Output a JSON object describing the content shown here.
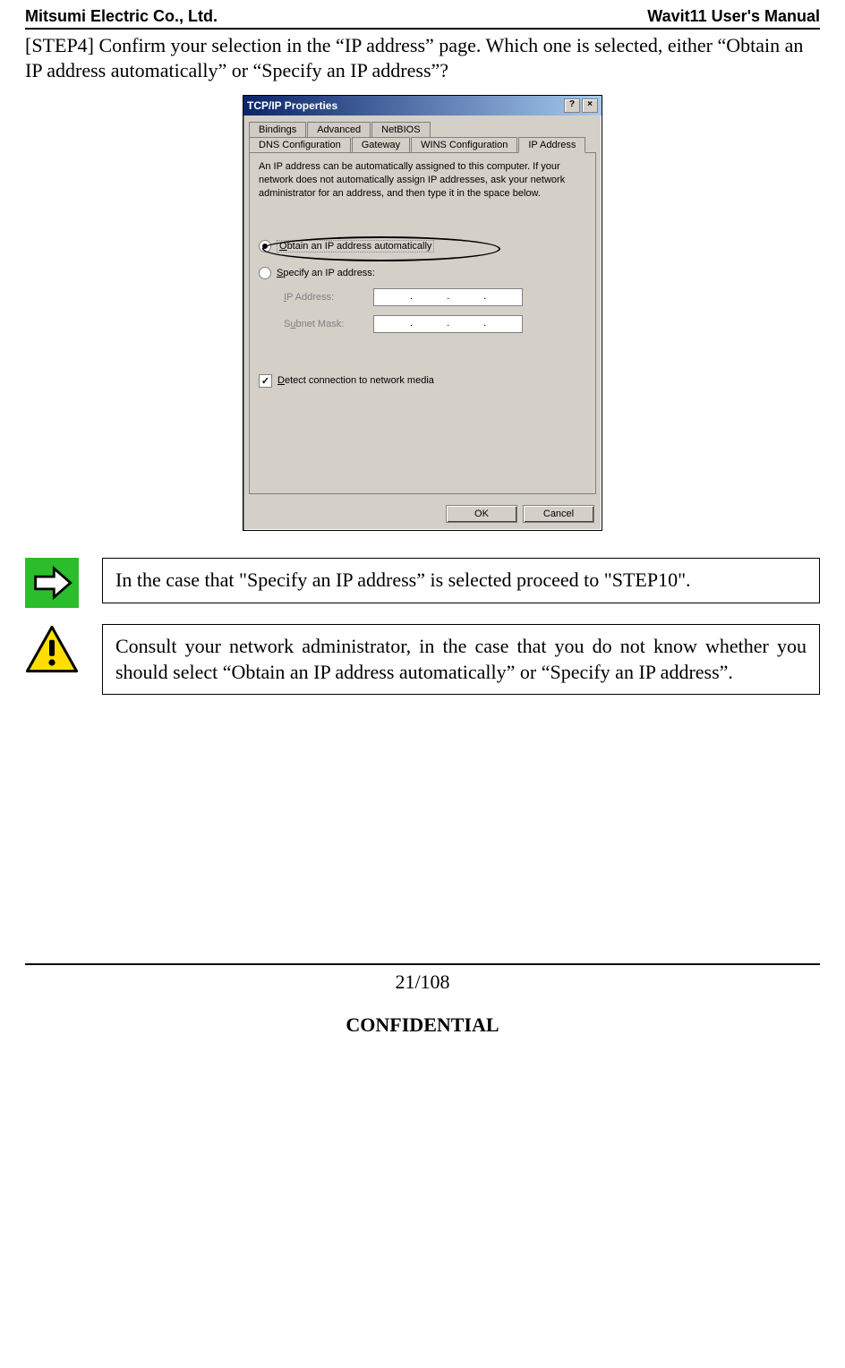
{
  "header": {
    "left": "Mitsumi Electric Co., Ltd.",
    "right": "Wavit11 User's Manual"
  },
  "intro": "[STEP4] Confirm your selection in the “IP address” page. Which one is selected, either “Obtain an IP address automatically” or “Specify an IP address”?",
  "dialog": {
    "title": "TCP/IP Properties",
    "help_glyph": "?",
    "close_glyph": "×",
    "tabs_row1": [
      "Bindings",
      "Advanced",
      "NetBIOS"
    ],
    "tabs_row2": [
      "DNS Configuration",
      "Gateway",
      "WINS Configuration",
      "IP Address"
    ],
    "active_tab": "IP Address",
    "description": "An IP address can be automatically assigned to this computer. If your network does not automatically assign IP addresses, ask your network administrator for an address, and then type it in the space below.",
    "radio_obtain": "Obtain an IP address automatically",
    "radio_obtain_selected": true,
    "radio_specify": "Specify an IP address:",
    "radio_specify_selected": false,
    "field_ip_label": "IP Address:",
    "field_subnet_label": "Subnet Mask:",
    "detect_label": "Detect connection to network media",
    "detect_checked": true,
    "btn_ok": "OK",
    "btn_cancel": "Cancel"
  },
  "note_go": "In the case that \"Specify an IP address” is selected proceed to \"STEP10\".",
  "note_warn": "Consult your network administrator, in the case that you do not know whether you should select “Obtain an IP address automatically” or “Specify an IP address”.",
  "footer": {
    "page": "21/108",
    "confidential": "CONFIDENTIAL"
  }
}
